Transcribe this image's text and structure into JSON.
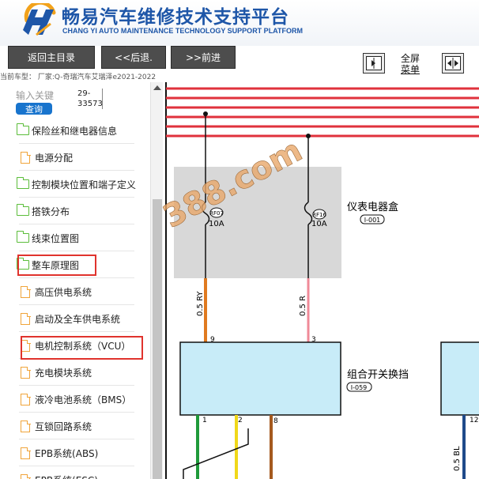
{
  "header": {
    "title_cn": "畅易汽车维修技术支持平台",
    "title_en": "CHANG YI AUTO MAINTENANCE TECHNOLOGY SUPPORT PLATFORM",
    "logo_icon": "cy-logo-icon"
  },
  "toolbar": {
    "home_label": "返回主目录",
    "back_label": "<<后退.",
    "forward_label": ">>前进",
    "fullscreen_line1": "全屏",
    "fullscreen_line2": "菜单"
  },
  "model_line": "当前车型：  厂家:Q-奇瑞汽车艾瑞泽e2021-2022",
  "search": {
    "placeholder": "输入关键",
    "button_label": "查询",
    "part_number": "29-33573"
  },
  "tree": [
    {
      "label": "保险丝和继电器信息",
      "type": "folder"
    },
    {
      "label": "电源分配",
      "type": "doc"
    },
    {
      "label": "控制模块位置和端子定义",
      "type": "folder"
    },
    {
      "label": "搭铁分布",
      "type": "folder"
    },
    {
      "label": "线束位置图",
      "type": "folder"
    },
    {
      "label": "整车原理图",
      "type": "folder",
      "highlighted": true
    },
    {
      "label": "高压供电系统",
      "type": "doc"
    },
    {
      "label": "启动及全车供电系统",
      "type": "doc"
    },
    {
      "label": "电机控制系统（VCU）",
      "type": "doc",
      "highlighted": true
    },
    {
      "label": "充电模块系统",
      "type": "doc"
    },
    {
      "label": "液冷电池系统（BMS）",
      "type": "doc"
    },
    {
      "label": "互锁回路系统",
      "type": "doc"
    },
    {
      "label": "EPB系统(ABS)",
      "type": "doc"
    },
    {
      "label": "EPB系统(ESC)",
      "type": "doc"
    }
  ],
  "diagram": {
    "watermark": "388.com",
    "fuse_box_label": "仪表电器盒",
    "fuse_box_code": "I-001",
    "fuse1_id": "RF07",
    "fuse1_rating": "10A",
    "fuse2_id": "RF16",
    "fuse2_rating": "10A",
    "wire1_label": "0.5 RY",
    "wire2_label": "0.5 R",
    "wire3_label": "0.5 BL",
    "pin_9": "9",
    "pin_3": "3",
    "pin_1": "1",
    "pin_2": "2",
    "pin_8": "8",
    "pin_12": "12",
    "switch_label": "组合开关换挡",
    "switch_code": "I-059",
    "colors": {
      "bus_red": "#e0323c",
      "box_gray": "#d8d8d8",
      "module_blue": "#c8ecf8",
      "wire_orange": "#e07a1f",
      "wire_pink": "#f08a98",
      "wire_green": "#1f9a3a",
      "wire_yellow": "#f0d81a",
      "wire_brown": "#a55a1f",
      "wire_blue": "#1f4a8a"
    }
  }
}
